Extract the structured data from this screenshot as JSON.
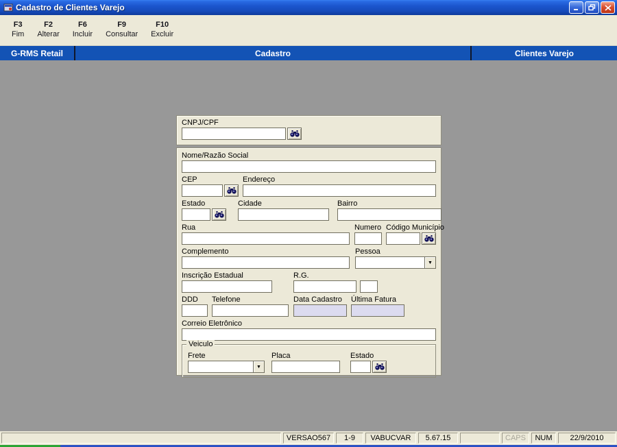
{
  "titlebar": {
    "title": "Cadastro de Clientes Varejo"
  },
  "toolbar": {
    "buttons": [
      {
        "key": "F3",
        "label": "Fim"
      },
      {
        "key": "F2",
        "label": "Alterar"
      },
      {
        "key": "F6",
        "label": "Incluir"
      },
      {
        "key": "F9",
        "label": "Consultar"
      },
      {
        "key": "F10",
        "label": "Excluir"
      }
    ]
  },
  "header": {
    "left": "G-RMS Retail",
    "center": "Cadastro",
    "right": "Clientes Varejo"
  },
  "form": {
    "labels": {
      "cnpj": "CNPJ/CPF",
      "nome": "Nome/Razão Social",
      "cep": "CEP",
      "endereco": "Endereço",
      "estado": "Estado",
      "cidade": "Cidade",
      "bairro": "Bairro",
      "rua": "Rua",
      "numero": "Numero",
      "codigo_municipio": "Código Município",
      "complemento": "Complemento",
      "pessoa": "Pessoa",
      "inscricao_estadual": "Inscrição Estadual",
      "rg": "R.G.",
      "ddd": "DDD",
      "telefone": "Telefone",
      "data_cadastro": "Data Cadastro",
      "ultima_fatura": "Última Fatura",
      "correio": "Correio Eletrônico",
      "veiculo": "Veiculo",
      "frete": "Frete",
      "placa": "Placa",
      "estado_veiculo": "Estado"
    },
    "values": {
      "cnpj": "",
      "nome": "",
      "cep": "",
      "endereco": "",
      "estado": "",
      "cidade": "",
      "bairro": "",
      "rua": "",
      "numero": "",
      "codigo_municipio": "",
      "complemento": "",
      "pessoa": "",
      "inscricao_estadual": "",
      "rg1": "",
      "rg2": "",
      "ddd": "",
      "telefone": "",
      "data_cadastro": "",
      "ultima_fatura": "",
      "correio": "",
      "frete": "",
      "placa": "",
      "estado_veiculo": ""
    }
  },
  "icons": {
    "dropdown_arrow": "▼"
  },
  "statusbar": {
    "versao": "VERSAO567",
    "record": "1-9",
    "user": "VABUCVAR",
    "version": "5.67.15",
    "blank": "",
    "caps": "CAPS",
    "num": "NUM",
    "date": "22/9/2010"
  }
}
